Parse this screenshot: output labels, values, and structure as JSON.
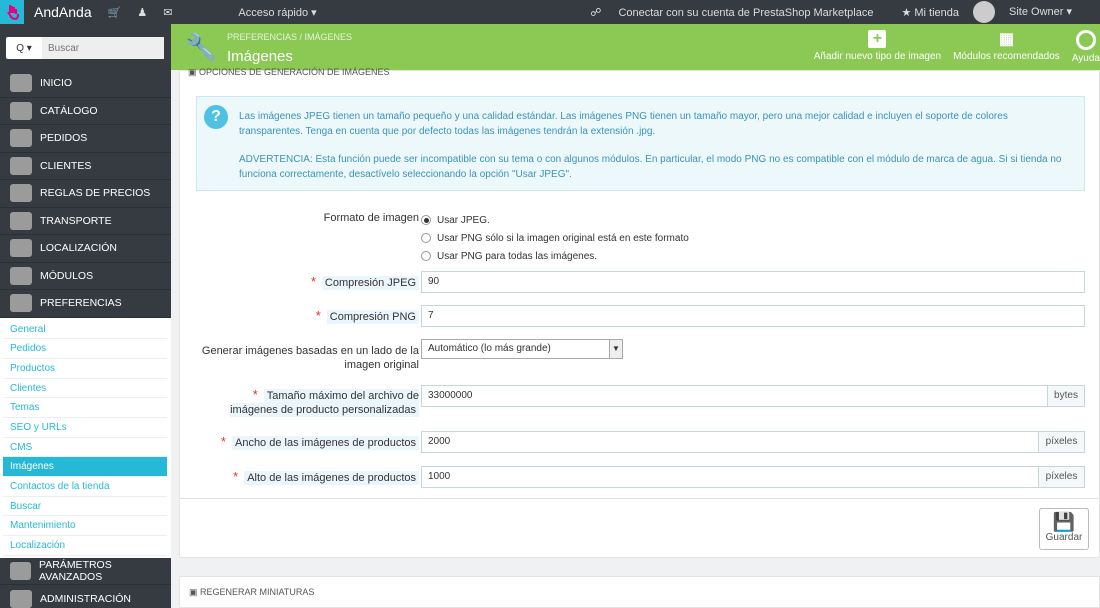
{
  "topbar": {
    "brand": "AndAnda",
    "quick_access": "Acceso rápido ▾",
    "marketplace": "Conectar con su cuenta de PrestaShop Marketplace",
    "my_store": "★ Mi tienda",
    "user": "Site Owner ▾"
  },
  "sidebar": {
    "search_placeholder": "Buscar",
    "search_btn": "Q ▾",
    "items": [
      {
        "label": "INICIO"
      },
      {
        "label": "CATÁLOGO"
      },
      {
        "label": "PEDIDOS"
      },
      {
        "label": "CLIENTES"
      },
      {
        "label": "REGLAS DE PRECIOS"
      },
      {
        "label": "TRANSPORTE"
      },
      {
        "label": "LOCALIZACIÓN"
      },
      {
        "label": "MÓDULOS"
      },
      {
        "label": "PREFERENCIAS"
      }
    ],
    "sub_items": [
      {
        "label": "General"
      },
      {
        "label": "Pedidos"
      },
      {
        "label": "Productos"
      },
      {
        "label": "Clientes"
      },
      {
        "label": "Temas"
      },
      {
        "label": "SEO y URLs"
      },
      {
        "label": "CMS"
      },
      {
        "label": "Imágenes"
      },
      {
        "label": "Contactos de la tienda"
      },
      {
        "label": "Buscar"
      },
      {
        "label": "Mantenimiento"
      },
      {
        "label": "Localización"
      }
    ],
    "bottom_items": [
      {
        "label": "PARÁMETROS AVANZADOS"
      },
      {
        "label": "ADMINISTRACIÓN"
      }
    ]
  },
  "header": {
    "breadcrumb": "PREFERENCIAS  /  IMÁGENES",
    "title": "Imágenes",
    "add_image_type": "Añadir nuevo tipo de imagen",
    "recommended_modules": "Módulos recomendados",
    "help": "Ayuda"
  },
  "panel": {
    "heading": "OPCIONES DE GENERACIÓN DE IMÁGENES",
    "info_p1": "Las imágenes JPEG tienen un tamaño pequeño y una calidad estándar. Las imágenes PNG tienen un tamaño mayor, pero una mejor calidad e incluyen el soporte de colores transparentes. Tenga en cuenta que por defecto todas las imágenes tendrán la extensión .jpg.",
    "info_p2": "ADVERTENCIA: Esta función puede ser incompatible con su tema o con algunos módulos. En particular, el modo PNG no es compatible con el módulo de marca de agua. Si si tienda no funciona correctamente, desactívelo seleccionando la opción \"Usar JPEG\".",
    "format_label": "Formato de imagen",
    "format_options": [
      "Usar JPEG.",
      "Usar PNG sólo si la imagen original está en este formato",
      "Usar PNG para todas las imágenes."
    ],
    "jpeg_label": "Compresión JPEG",
    "jpeg_value": "90",
    "png_label": "Compresión PNG",
    "png_value": "7",
    "side_label": "Generar imágenes basadas en un lado de la imagen original",
    "side_value": "Automático (lo más grande)",
    "maxsize_label": "Tamaño máximo del archivo de imágenes de producto personalizadas",
    "maxsize_value": "33000000",
    "maxsize_unit": "bytes",
    "width_label": "Ancho de las imágenes de productos",
    "width_value": "2000",
    "width_unit": "píxeles",
    "height_label": "Alto de las imágenes de productos",
    "height_value": "1000",
    "height_unit": "píxeles",
    "save": "Guardar"
  },
  "panel2": {
    "heading": "REGENERAR MINIATURAS"
  }
}
